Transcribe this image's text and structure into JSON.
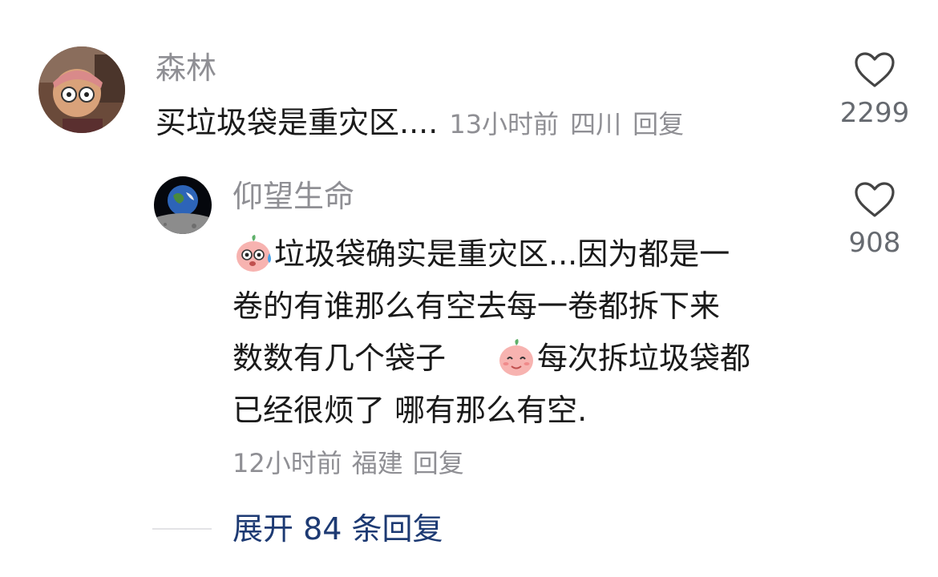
{
  "comment": {
    "username": "森林",
    "text": "买垃圾袋是重灾区....",
    "time": "13小时前",
    "location": "四川",
    "reply_label": "回复",
    "likes": "2299",
    "avatar_icon": "cartoon-character-avatar"
  },
  "reply": {
    "username": "仰望生命",
    "lines": {
      "l1": "垃圾袋确实是重灾区...因为都是一",
      "l2": "卷的有谁那么有空去每一卷都拆下来",
      "l3a": "数数有几个袋子",
      "l3b": "每次拆垃圾袋都",
      "l4": "已经很烦了 哪有那么有空."
    },
    "time": "12小时前",
    "location": "福建",
    "reply_label": "回复",
    "likes": "908",
    "avatar_icon": "earth-from-moon-avatar",
    "emoji_1": "sweating-peach-emoji",
    "emoji_2": "smiling-peach-emoji"
  },
  "expand": {
    "label": "展开 84 条回复"
  },
  "colors": {
    "text": "#1a1a1a",
    "muted": "#8f8f94",
    "link": "#1d3a73"
  }
}
